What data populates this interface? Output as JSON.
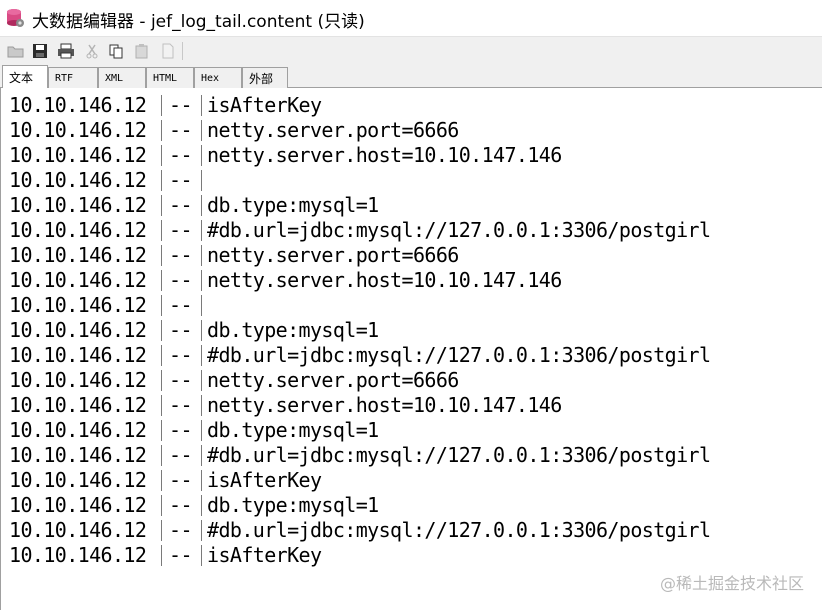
{
  "window": {
    "title": "大数据编辑器 - jef_log_tail.content (只读)"
  },
  "toolbar": {
    "buttons": [
      {
        "name": "open-folder-icon",
        "enabled": true
      },
      {
        "name": "save-icon",
        "enabled": true
      },
      {
        "name": "print-icon",
        "enabled": true
      },
      {
        "name": "cut-icon",
        "enabled": false
      },
      {
        "name": "copy-icon",
        "enabled": true
      },
      {
        "name": "paste-icon",
        "enabled": false
      },
      {
        "name": "new-document-icon",
        "enabled": false
      }
    ]
  },
  "tabs": [
    {
      "label": "文本",
      "active": true
    },
    {
      "label": "RTF",
      "active": false
    },
    {
      "label": "XML",
      "active": false
    },
    {
      "label": "HTML",
      "active": false
    },
    {
      "label": "Hex",
      "active": false
    },
    {
      "label": "外部",
      "active": false
    }
  ],
  "log": {
    "lines": [
      {
        "ip": "10.10.146.12",
        "sep": "--",
        "msg": "isAfterKey"
      },
      {
        "ip": "10.10.146.12",
        "sep": "--",
        "msg": "netty.server.port=6666"
      },
      {
        "ip": "10.10.146.12",
        "sep": "--",
        "msg": "netty.server.host=10.10.147.146"
      },
      {
        "ip": "10.10.146.12",
        "sep": "--",
        "msg": ""
      },
      {
        "ip": "10.10.146.12",
        "sep": "--",
        "msg": "db.type:mysql=1"
      },
      {
        "ip": "10.10.146.12",
        "sep": "--",
        "msg": "#db.url=jdbc:mysql://127.0.0.1:3306/postgirl"
      },
      {
        "ip": "10.10.146.12",
        "sep": "--",
        "msg": "netty.server.port=6666"
      },
      {
        "ip": "10.10.146.12",
        "sep": "--",
        "msg": "netty.server.host=10.10.147.146"
      },
      {
        "ip": "10.10.146.12",
        "sep": "--",
        "msg": ""
      },
      {
        "ip": "10.10.146.12",
        "sep": "--",
        "msg": "db.type:mysql=1"
      },
      {
        "ip": "10.10.146.12",
        "sep": "--",
        "msg": "#db.url=jdbc:mysql://127.0.0.1:3306/postgirl"
      },
      {
        "ip": "10.10.146.12",
        "sep": "--",
        "msg": "netty.server.port=6666"
      },
      {
        "ip": "10.10.146.12",
        "sep": "--",
        "msg": "netty.server.host=10.10.147.146"
      },
      {
        "ip": "10.10.146.12",
        "sep": "--",
        "msg": "db.type:mysql=1"
      },
      {
        "ip": "10.10.146.12",
        "sep": "--",
        "msg": "#db.url=jdbc:mysql://127.0.0.1:3306/postgirl"
      },
      {
        "ip": "10.10.146.12",
        "sep": "--",
        "msg": "isAfterKey"
      },
      {
        "ip": "10.10.146.12",
        "sep": "--",
        "msg": "db.type:mysql=1"
      },
      {
        "ip": "10.10.146.12",
        "sep": "--",
        "msg": "#db.url=jdbc:mysql://127.0.0.1:3306/postgirl"
      },
      {
        "ip": "10.10.146.12",
        "sep": "--",
        "msg": "isAfterKey"
      }
    ]
  },
  "watermark": "@稀土掘金技术社区"
}
